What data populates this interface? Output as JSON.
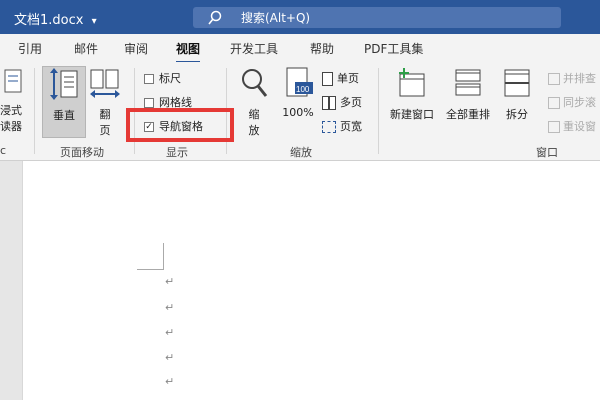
{
  "titlebar": {
    "doc_title": "文档1.docx",
    "dropdown_glyph": "▾",
    "search_text": "搜索(Alt+Q)"
  },
  "tabs": [
    {
      "label": "引用",
      "active": false
    },
    {
      "label": "邮件",
      "active": false
    },
    {
      "label": "审阅",
      "active": false
    },
    {
      "label": "视图",
      "active": true
    },
    {
      "label": "开发工具",
      "active": false
    },
    {
      "label": "帮助",
      "active": false
    },
    {
      "label": "PDF工具集",
      "active": false
    }
  ],
  "ribbon": {
    "immersive": {
      "label_line1": "浸式",
      "label_line2": "读器"
    },
    "page_move": {
      "vertical_label": "垂直",
      "flip_label_1": "翻",
      "flip_label_2": "页",
      "group_label": "页面移动"
    },
    "show": {
      "ruler": {
        "label": "标尺",
        "checked": false
      },
      "gridlines": {
        "label": "网格线",
        "checked": false
      },
      "nav_pane": {
        "label": "导航窗格",
        "checked": true
      },
      "group_label": "显示"
    },
    "zoom": {
      "zoom_label_1": "缩",
      "zoom_label_2": "放",
      "hundred_label": "100%",
      "hundred_badge": "100",
      "single_page": "单页",
      "multi_page": "多页",
      "page_width": "页宽",
      "group_label": "缩放"
    },
    "window": {
      "new_window": "新建窗口",
      "arrange_all": "全部重排",
      "split": "拆分",
      "side_by_side": "并排查",
      "sync_scroll": "同步滚",
      "reset_pos": "重设窗",
      "group_label": "窗口"
    }
  },
  "document": {
    "paragraph_mark": "↵",
    "left_label": "c"
  },
  "colors": {
    "brand": "#2b579a",
    "highlight": "#e53935"
  }
}
